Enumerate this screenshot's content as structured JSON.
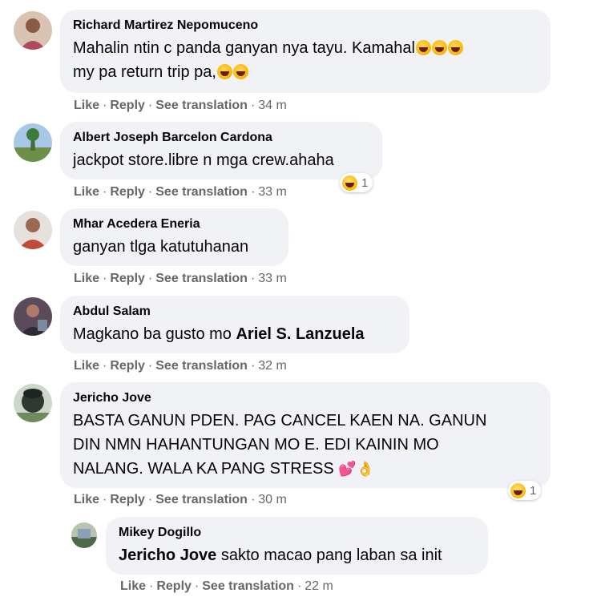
{
  "actions": {
    "like": "Like",
    "reply": "Reply",
    "see_translation": "See translation",
    "separator": "·"
  },
  "comments": [
    {
      "author": "Richard Martirez Nepomuceno",
      "text_line1": "Mahalin ntin c panda ganyan nya tayu. Kamahal",
      "text_line2": "my pa return trip pa,",
      "time": "34 m"
    },
    {
      "author": "Albert Joseph Barcelon Cardona",
      "text": "jackpot store.libre n mga crew.ahaha",
      "time": "33 m",
      "reaction_count": "1"
    },
    {
      "author": "Mhar Acedera Eneria",
      "text": "ganyan tlga katutuhanan",
      "time": "33 m"
    },
    {
      "author": "Abdul Salam",
      "text": "Magkano ba gusto mo ",
      "mention": "Ariel S. Lanzuela",
      "time": "32 m"
    },
    {
      "author": "Jericho Jove",
      "text_line1": "BASTA GANUN PDEN. PAG CANCEL KAEN NA. GANUN",
      "text_line2": "DIN NMN HAHANTUNGAN MO E. EDI KAININ MO",
      "text_line3": "NALANG. WALA KA PANG STRESS ",
      "time": "30 m",
      "reaction_count": "1"
    }
  ],
  "reply": {
    "author": "Mikey Dogillo",
    "mention": "Jericho Jove",
    "text": " sakto macao pang laban sa init",
    "time": "22 m"
  },
  "colors": {
    "bubble": "#f0f2f5",
    "meta_text": "#65676b",
    "text": "#050505"
  }
}
